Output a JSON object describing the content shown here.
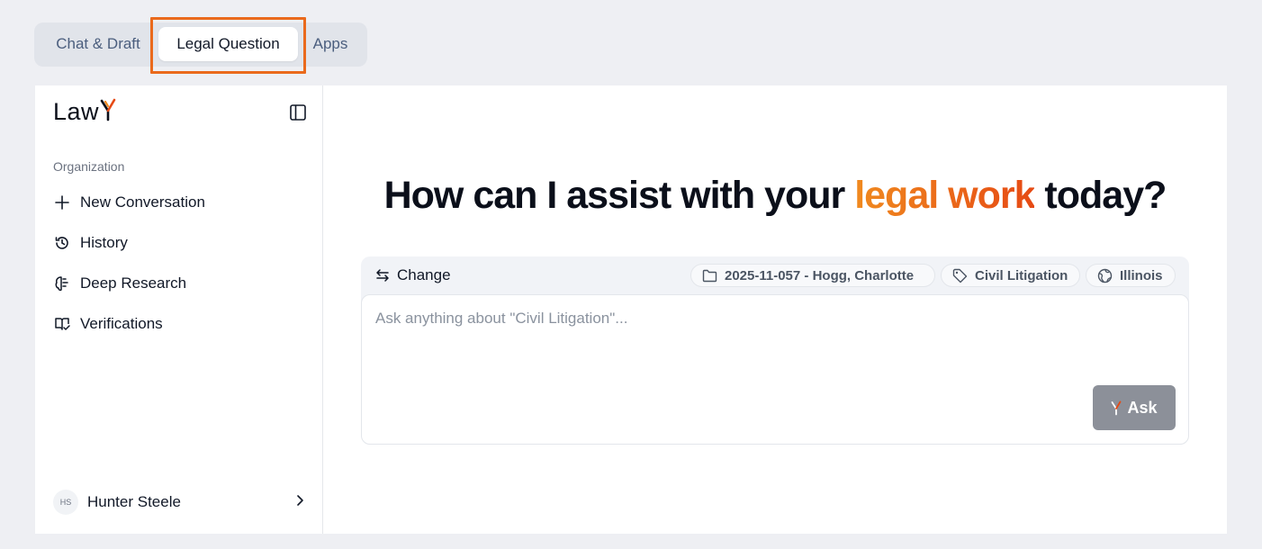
{
  "tabs": {
    "chat_label": "Chat & Draft",
    "legal_label": "Legal Question",
    "apps_label": "Apps",
    "active": "Legal Question"
  },
  "sidebar": {
    "logo_text": "Law",
    "section_label": "Organization",
    "items": [
      {
        "label": "New Conversation",
        "icon": "plus-icon"
      },
      {
        "label": "History",
        "icon": "history-icon"
      },
      {
        "label": "Deep Research",
        "icon": "brain-icon"
      },
      {
        "label": "Verifications",
        "icon": "book-check-icon"
      }
    ],
    "user": {
      "initials": "HS",
      "name": "Hunter Steele"
    }
  },
  "main": {
    "heading_prefix": "How can I assist with your ",
    "heading_accent": "legal work",
    "heading_suffix": " today?",
    "change_label": "Change",
    "chips": {
      "case": "2025-11-057 - Hogg, Charlotte",
      "practice_area": "Civil Litigation",
      "jurisdiction": "Illinois"
    },
    "input_placeholder": "Ask anything about \"Civil Litigation\"...",
    "ask_label": "Ask"
  },
  "colors": {
    "accent_start": "#f08a1f",
    "accent_end": "#e64a14",
    "highlight_border": "#ea6a1c",
    "ask_button_bg": "#8c9099"
  }
}
